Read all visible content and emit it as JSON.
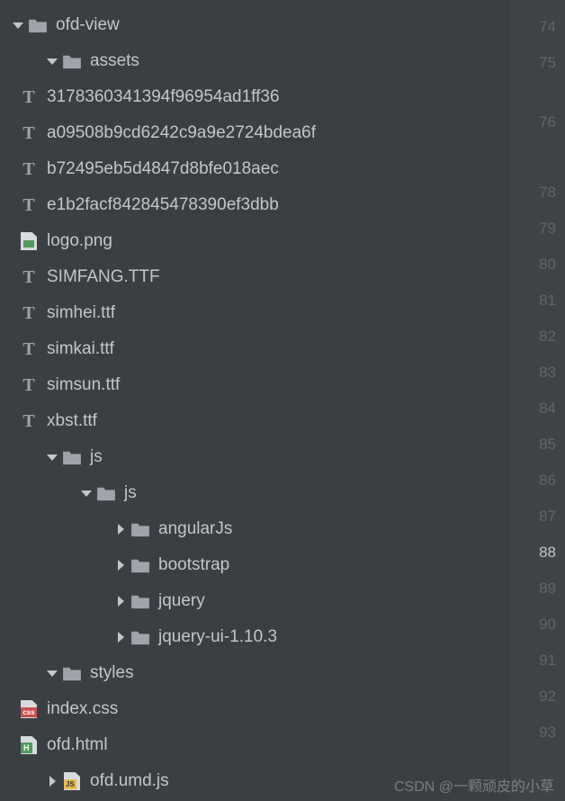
{
  "tree": {
    "root": {
      "name": "ofd-view"
    },
    "assets": {
      "name": "assets",
      "files": [
        "3178360341394f96954ad1ff36",
        "a09508b9cd6242c9a9e2724bdea6f",
        "b72495eb5d4847d8bfe018aec",
        "e1b2facf842845478390ef3dbb",
        "logo.png",
        "SIMFANG.TTF",
        "simhei.ttf",
        "simkai.ttf",
        "simsun.ttf",
        "xbst.ttf"
      ]
    },
    "js": {
      "name": "js",
      "inner": {
        "name": "js"
      },
      "folders": [
        "angularJs",
        "bootstrap",
        "jquery",
        "jquery-ui-1.10.3"
      ]
    },
    "styles": {
      "name": "styles",
      "files": [
        "index.css"
      ]
    },
    "rootFiles": {
      "html": "ofd.html",
      "js": "ofd.umd.js"
    }
  },
  "gutter": {
    "lines": [
      "74",
      "75",
      "76",
      "",
      "78",
      "79",
      "80",
      "81",
      "82",
      "83",
      "84",
      "85",
      "86",
      "87",
      "88",
      "89",
      "90",
      "91",
      "92",
      "93"
    ],
    "tallIndex": 2,
    "activeIndex": 14
  },
  "watermark": "CSDN @一颗顽皮的小草"
}
